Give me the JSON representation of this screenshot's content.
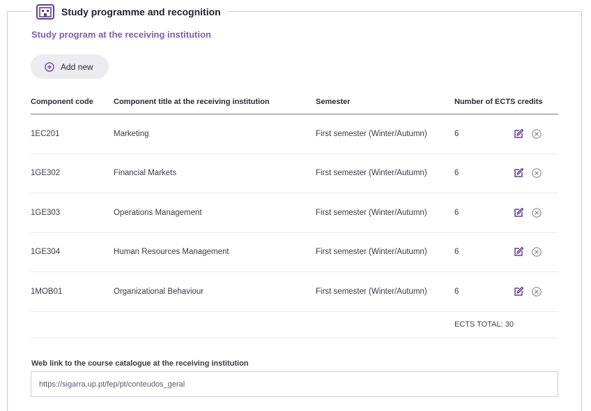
{
  "section": {
    "legend_title": "Study programme and recognition",
    "subtitle": "Study program at the receiving institution",
    "add_button_label": "Add new",
    "legend_icon": "building-icon",
    "accent_color": "#7a5fb0"
  },
  "table": {
    "headers": {
      "code": "Component code",
      "title": "Component title at the receiving institution",
      "semester": "Semester",
      "credits": "Number of ECTS credits"
    },
    "rows": [
      {
        "code": "1EC201",
        "title": "Marketing",
        "semester": "First semester (Winter/Autumn)",
        "credits": "6"
      },
      {
        "code": "1GE302",
        "title": "Financial Markets",
        "semester": "First semester (Winter/Autumn)",
        "credits": "6"
      },
      {
        "code": "1GE303",
        "title": "Operations Management",
        "semester": "First semester (Winter/Autumn)",
        "credits": "6"
      },
      {
        "code": "1GE304",
        "title": "Human Resources Management",
        "semester": "First semester (Winter/Autumn)",
        "credits": "6"
      },
      {
        "code": "1MOB01",
        "title": "Organizational Behaviour",
        "semester": "First semester (Winter/Autumn)",
        "credits": "6"
      }
    ],
    "total_label": "ECTS TOTAL: 30",
    "row_actions": [
      "edit-icon",
      "remove-icon"
    ]
  },
  "weblink": {
    "label": "Web link to the course catalogue at the receiving institution",
    "value": "https://sigarra.up.pt/fep/pt/conteudos_geral"
  }
}
